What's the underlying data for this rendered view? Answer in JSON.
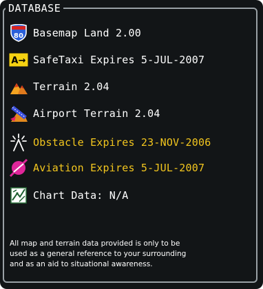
{
  "section": {
    "title": "DATABASE"
  },
  "items": [
    {
      "label": "Basemap Land 2.00",
      "icon": "interstate-shield-icon",
      "color": "#ffffff"
    },
    {
      "label": "SafeTaxi  Expires 5-JUL-2007",
      "icon": "safetaxi-icon",
      "color": "#ffffff"
    },
    {
      "label": "Terrain 2.04",
      "icon": "terrain-icon",
      "color": "#ffffff"
    },
    {
      "label": "Airport Terrain 2.04",
      "icon": "airport-terrain-icon",
      "color": "#ffffff"
    },
    {
      "label": "Obstacle  Expires 23-NOV-2006",
      "icon": "obstacle-icon",
      "color": "#f3c61e"
    },
    {
      "label": "Aviation  Expires 5-JUL-2007",
      "icon": "aviation-icon",
      "color": "#f3c61e"
    },
    {
      "label": "Chart Data: N/A",
      "icon": "chart-data-icon",
      "color": "#ffffff"
    }
  ],
  "shield_number": "80",
  "safetaxi_badge": "A→",
  "footer": {
    "lines": [
      "All map and terrain data provided is only to be",
      "used as a general reference to your surrounding",
      "and as an aid to situational awareness."
    ]
  }
}
